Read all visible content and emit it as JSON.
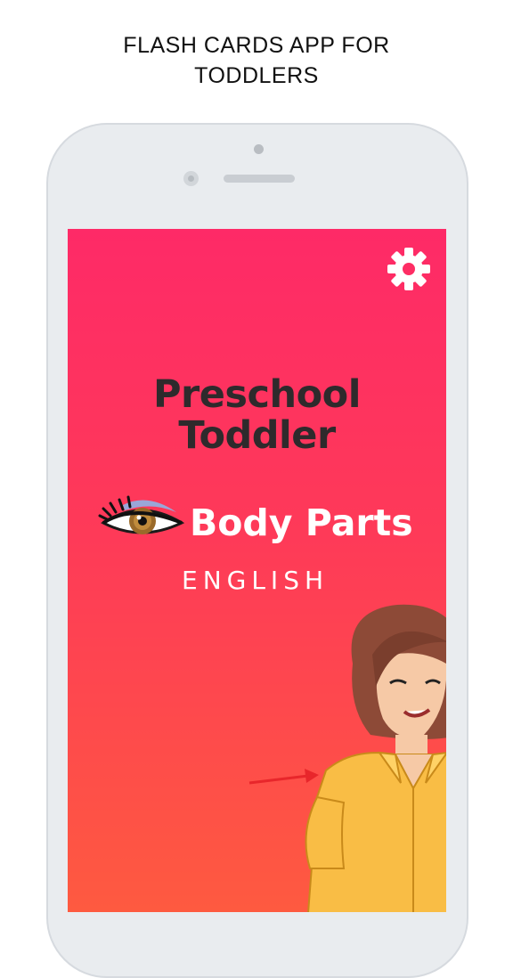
{
  "caption": {
    "line1": "FLASH CARDS APP FOR",
    "line2": "TODDLERS"
  },
  "app": {
    "title_line1": "Preschool",
    "title_line2": "Toddler",
    "subject": "Body Parts",
    "language": "ENGLISH",
    "settings_icon": "gear-icon",
    "subject_icon": "eye-icon"
  },
  "colors": {
    "screen_top": "#fe2a67",
    "screen_bottom": "#fe5a40",
    "title": "#2e2a2c",
    "shirt": "#f9bd45",
    "hair": "#8d4a37",
    "arrow": "#e8262b"
  }
}
